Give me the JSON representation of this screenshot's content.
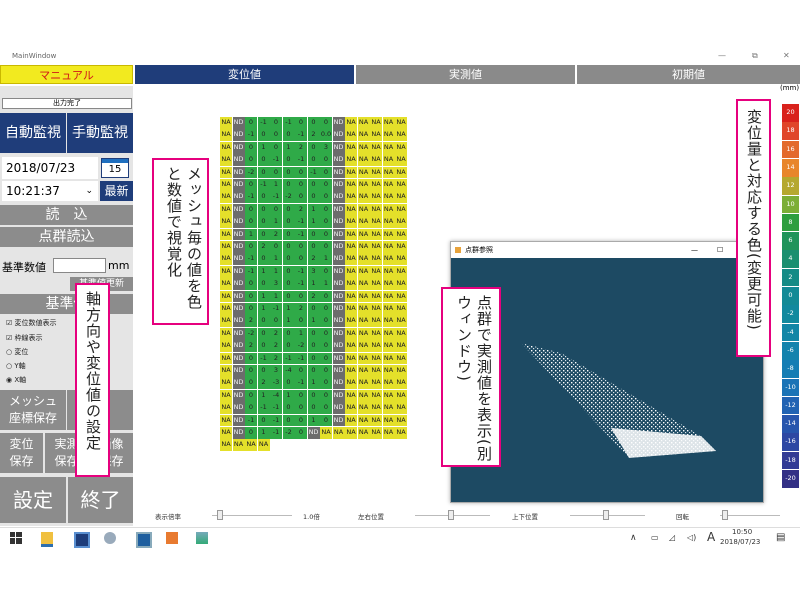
{
  "window": {
    "title": "MainWindow",
    "controls": [
      "—",
      "⧉",
      "✕"
    ]
  },
  "tabs": [
    {
      "label": "マニュアル"
    },
    {
      "label": "変位値"
    },
    {
      "label": "実測値"
    },
    {
      "label": "初期値"
    }
  ],
  "sidebar": {
    "status": "出力完了",
    "auto_monitor": "自動監視",
    "manual_monitor": "手動監視",
    "date": "2018/07/23",
    "calendar_day": "15",
    "time": "10:21:37",
    "latest": "最新",
    "read": "読　込",
    "pointcloud_read": "点群読込",
    "base_value_label": "基準数値",
    "base_value": "",
    "unit": "mm",
    "base_update": "基準値更新",
    "base_section": "基準値",
    "checks": [
      {
        "label": "変位数値表示",
        "checked": true
      },
      {
        "label": "枠線表示",
        "checked": true
      }
    ],
    "radios": [
      {
        "label": "変位",
        "checked": false
      },
      {
        "label": "Y軸",
        "checked": false
      },
      {
        "label": "X軸",
        "checked": true
      }
    ],
    "mesh_save_1": "メッシュ",
    "mesh_save_2": "座標保存",
    "disp_save_1": "変位",
    "disp_save_2": "保存",
    "meas_save_1": "実測",
    "meas_save_2": "保存",
    "img_save_1": "画像",
    "img_save_2": "保存",
    "settings": "設定",
    "exit": "終了"
  },
  "legend": {
    "unit": "(mm)",
    "values": [
      "20",
      "18",
      "16",
      "14",
      "12",
      "10",
      "8",
      "6",
      "4",
      "2",
      "0",
      "-2",
      "-4",
      "-6",
      "-8",
      "-10",
      "-12",
      "-14",
      "-16",
      "-18",
      "-20"
    ],
    "colors": [
      "#d9221c",
      "#e0462a",
      "#e36a2c",
      "#e8862b",
      "#b5a82f",
      "#7cae37",
      "#2e9e3f",
      "#20945a",
      "#1a8f70",
      "#158b86",
      "#138a96",
      "#12899e",
      "#1286a6",
      "#1383ad",
      "#157db4",
      "#1a73b6",
      "#2163b3",
      "#2856ad",
      "#2e48a3",
      "#323b95",
      "#333085"
    ]
  },
  "annotations": {
    "mesh": "メッシュ毎の値を色と数値で視覚化",
    "axis": "軸方向や変位値の設定",
    "pointcloud": "点群で実測値を表示(別ウィンドウ)",
    "colormap": "変位量と対応する色(変更可能)"
  },
  "pointcloud_window": {
    "title": "点群参照"
  },
  "grid": {
    "rows": [
      [
        "NA",
        "ND",
        "0",
        "-1",
        "0",
        "-1",
        "0",
        "0",
        "0",
        "ND",
        "NA",
        "NA",
        "NA",
        "NA",
        "NA"
      ],
      [
        "NA",
        "ND",
        "-1",
        "0",
        "0",
        "0",
        "-1",
        "2",
        "0.0",
        "ND",
        "NA",
        "NA",
        "NA",
        "NA",
        "NA"
      ],
      [
        "NA",
        "ND",
        "0",
        "1",
        "0",
        "1",
        "2",
        "0",
        "3",
        "ND",
        "NA",
        "NA",
        "NA",
        "NA",
        "NA"
      ],
      [
        "NA",
        "ND",
        "0",
        "0",
        "-1",
        "0",
        "-1",
        "0",
        "0",
        "ND",
        "NA",
        "NA",
        "NA",
        "NA",
        "NA"
      ],
      [
        "NA",
        "ND",
        "-2",
        "0",
        "0",
        "0",
        "0",
        "-1",
        "0",
        "ND",
        "NA",
        "NA",
        "NA",
        "NA",
        "NA"
      ],
      [
        "NA",
        "ND",
        "0",
        "-1",
        "1",
        "0",
        "0",
        "0",
        "0",
        "ND",
        "NA",
        "NA",
        "NA",
        "NA",
        "NA"
      ],
      [
        "NA",
        "ND",
        "-1",
        "0",
        "-1",
        "-2",
        "0",
        "0",
        "0",
        "ND",
        "NA",
        "NA",
        "NA",
        "NA",
        "NA"
      ],
      [
        "NA",
        "ND",
        "0",
        "0",
        "0",
        "0",
        "2",
        "1",
        "0",
        "ND",
        "NA",
        "NA",
        "NA",
        "NA",
        "NA"
      ],
      [
        "NA",
        "ND",
        "0",
        "0",
        "1",
        "0",
        "-1",
        "1",
        "0",
        "ND",
        "NA",
        "NA",
        "NA",
        "NA",
        "NA"
      ],
      [
        "NA",
        "ND",
        "1",
        "0",
        "2",
        "0",
        "-1",
        "0",
        "0",
        "ND",
        "NA",
        "NA",
        "NA",
        "NA",
        "NA"
      ],
      [
        "NA",
        "ND",
        "0",
        "2",
        "0",
        "0",
        "0",
        "0",
        "0",
        "ND",
        "NA",
        "NA",
        "NA",
        "NA",
        "NA"
      ],
      [
        "NA",
        "ND",
        "-1",
        "0",
        "1",
        "0",
        "0",
        "2",
        "1",
        "ND",
        "NA",
        "NA",
        "NA",
        "NA",
        "NA"
      ],
      [
        "NA",
        "ND",
        "-1",
        "1",
        "1",
        "0",
        "-1",
        "3",
        "0",
        "ND",
        "NA",
        "NA",
        "NA",
        "NA",
        "NA"
      ],
      [
        "NA",
        "ND",
        "0",
        "0",
        "3",
        "0",
        "-1",
        "1",
        "1",
        "ND",
        "NA",
        "NA",
        "NA",
        "NA",
        "NA"
      ],
      [
        "NA",
        "ND",
        "0",
        "1",
        "1",
        "0",
        "0",
        "2",
        "0",
        "ND",
        "NA",
        "NA",
        "NA",
        "NA",
        "NA"
      ],
      [
        "NA",
        "ND",
        "0",
        "1",
        "-1",
        "1",
        "2",
        "0",
        "0",
        "ND",
        "NA",
        "NA",
        "NA",
        "NA",
        "NA"
      ],
      [
        "NA",
        "ND",
        "2",
        "0",
        "0",
        "1",
        "0",
        "1",
        "0",
        "ND",
        "NA",
        "NA",
        "NA",
        "NA",
        "NA"
      ],
      [
        "NA",
        "ND",
        "-2",
        "0",
        "2",
        "0",
        "1",
        "0",
        "0",
        "ND",
        "NA",
        "NA",
        "NA",
        "NA",
        "NA"
      ],
      [
        "NA",
        "ND",
        "2",
        "0",
        "2",
        "0",
        "-2",
        "0",
        "0",
        "ND",
        "NA",
        "NA",
        "NA",
        "NA",
        "NA"
      ],
      [
        "NA",
        "ND",
        "0",
        "-1",
        "2",
        "-1",
        "-1",
        "0",
        "0",
        "ND",
        "NA",
        "NA",
        "NA",
        "NA",
        "NA"
      ],
      [
        "NA",
        "ND",
        "0",
        "0",
        "3",
        "-4",
        "0",
        "0",
        "0",
        "ND",
        "NA",
        "NA",
        "NA",
        "NA",
        "NA"
      ],
      [
        "NA",
        "ND",
        "0",
        "2",
        "-3",
        "0",
        "-1",
        "1",
        "0",
        "ND",
        "NA",
        "NA",
        "NA",
        "NA",
        "NA"
      ],
      [
        "NA",
        "ND",
        "0",
        "1",
        "-4",
        "1",
        "0",
        "0",
        "0",
        "ND",
        "NA",
        "NA",
        "NA",
        "NA",
        "NA"
      ],
      [
        "NA",
        "ND",
        "0",
        "-1",
        "-1",
        "0",
        "0",
        "0",
        "0",
        "ND",
        "NA",
        "NA",
        "NA",
        "NA",
        "NA"
      ],
      [
        "NA",
        "ND",
        "-1",
        "0",
        "-1",
        "0",
        "0",
        "1",
        "0",
        "ND",
        "NA",
        "NA",
        "NA",
        "NA",
        "NA"
      ],
      [
        "NA",
        "ND",
        "0",
        "1",
        "-1",
        "-2",
        "0",
        "ND",
        "NA",
        "NA",
        "NA",
        "NA",
        "NA",
        "NA",
        "NA"
      ],
      [
        "NA",
        "NA",
        "NA",
        "NA"
      ]
    ]
  },
  "bottom": {
    "zoom_label": "表示倍率",
    "zoom_value": "1.0倍",
    "lr_label": "左右位置",
    "ud_label": "上下位置",
    "rotate_label": "回転"
  },
  "taskbar": {
    "time": "10:50",
    "date": "2018/07/23",
    "ime": "A"
  }
}
